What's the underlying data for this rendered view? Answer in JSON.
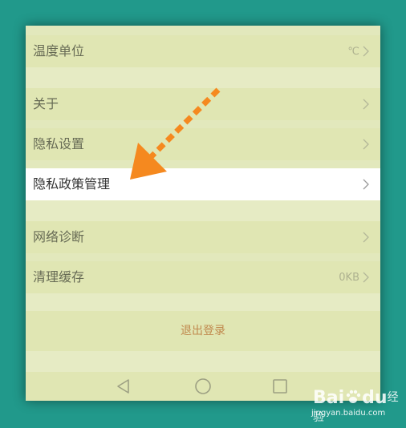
{
  "settings": {
    "temperature_unit": {
      "label": "温度单位",
      "value": "℃"
    },
    "about": {
      "label": "关于"
    },
    "privacy_settings": {
      "label": "隐私设置"
    },
    "privacy_policy": {
      "label": "隐私政策管理"
    },
    "network_diagnosis": {
      "label": "网络诊断"
    },
    "clear_cache": {
      "label": "清理缓存",
      "value": "0KB"
    }
  },
  "logout": {
    "label": "退出登录"
  },
  "navbar": {
    "back_icon": "triangle-back-icon",
    "home_icon": "circle-home-icon",
    "recents_icon": "square-recents-icon"
  },
  "annotation": {
    "arrow_color": "#f5891f"
  },
  "watermark": {
    "brand_a": "Bai",
    "brand_b": "du",
    "brand_c": "经验",
    "url": "jingyan.baidu.com"
  },
  "colors": {
    "background": "#21998b",
    "screen": "#e2e8bc",
    "highlight": "#ffffff",
    "logout_text": "#c0894e"
  }
}
